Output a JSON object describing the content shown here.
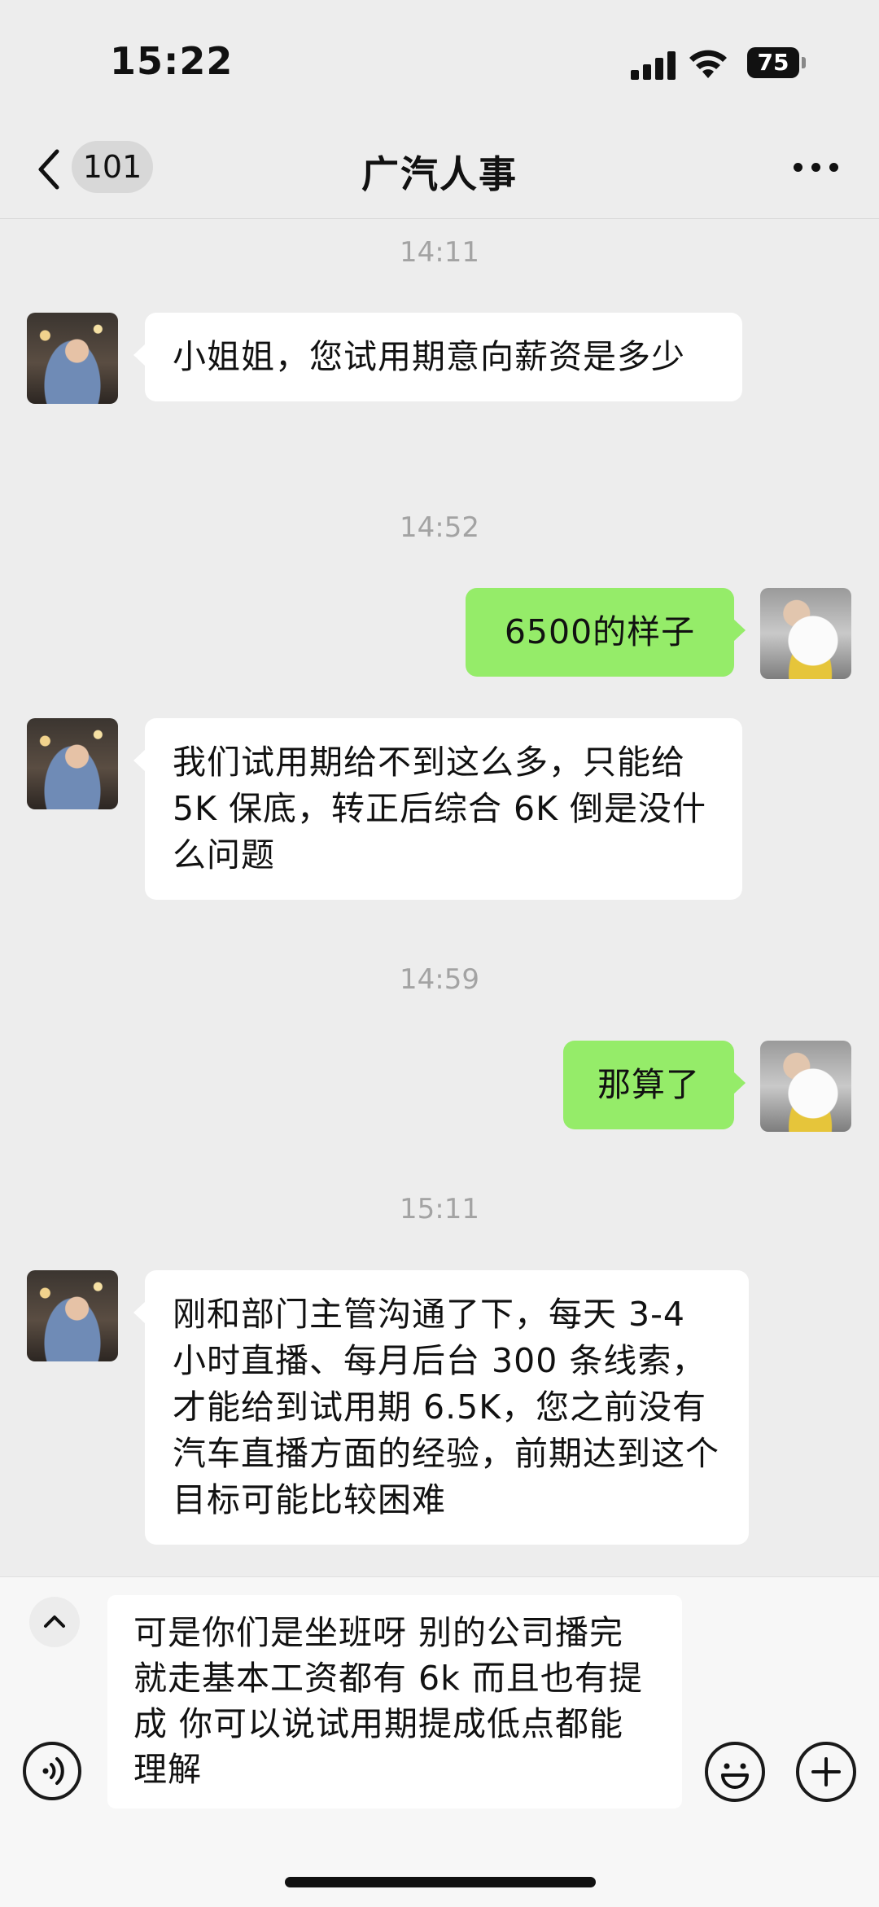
{
  "status_bar": {
    "time": "15:22",
    "battery": "75",
    "icons": [
      "signal-icon",
      "wifi-icon",
      "battery-icon"
    ]
  },
  "nav": {
    "back_icon": "chevron-left-icon",
    "unread_count": "101",
    "title": "广汽人事",
    "more_icon": "more-horizontal-icon"
  },
  "messages": [
    {
      "kind": "time",
      "text": "14:11"
    },
    {
      "kind": "incoming",
      "sender": "hr",
      "text": "小姐姐，您试用期意向薪资是多少"
    },
    {
      "kind": "time",
      "text": "14:52"
    },
    {
      "kind": "outgoing",
      "sender": "self",
      "text": "6500的样子"
    },
    {
      "kind": "incoming",
      "sender": "hr",
      "text": "我们试用期给不到这么多，只能给 5K 保底，转正后综合 6K 倒是没什么问题"
    },
    {
      "kind": "time",
      "text": "14:59"
    },
    {
      "kind": "outgoing",
      "sender": "self",
      "text": "那算了"
    },
    {
      "kind": "time",
      "text": "15:11"
    },
    {
      "kind": "incoming",
      "sender": "hr",
      "text": "刚和部门主管沟通了下，每天 3-4 小时直播、每月后台 300 条线索，才能给到试用期 6.5K，您之前没有汽车直播方面的经验，前期达到这个目标可能比较困难"
    }
  ],
  "input_bar": {
    "draft_text": "可是你们是坐班呀 别的公司播完就走基本工资都有 6k 而且也有提成 你可以说试用期提成低点都能理解",
    "icons": [
      "chevron-up-icon",
      "voice-icon",
      "emoji-icon",
      "plus-icon"
    ]
  },
  "colors": {
    "background": "#ededed",
    "incoming_bubble": "#ffffff",
    "outgoing_bubble": "#95ec69",
    "timestamp": "#a3a3a3"
  }
}
